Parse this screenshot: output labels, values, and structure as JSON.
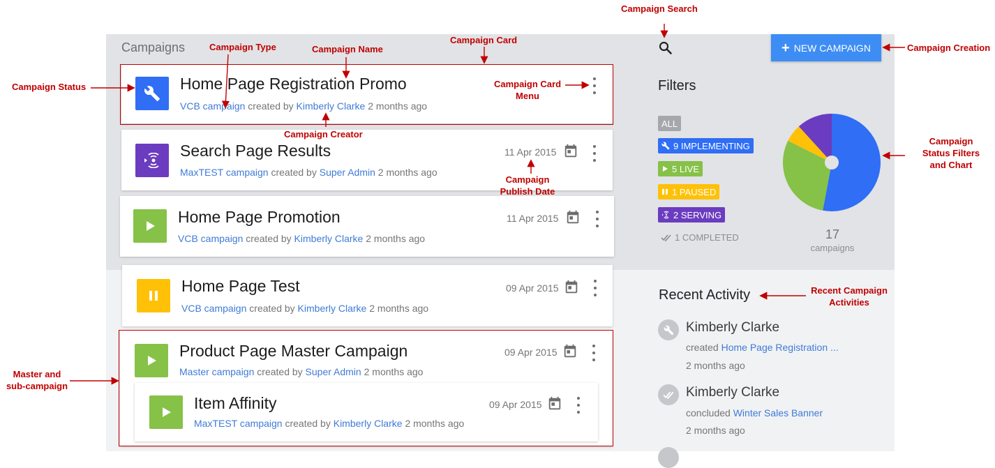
{
  "header": {
    "title": "Campaigns",
    "new_campaign_label": "NEW CAMPAIGN",
    "search_icon": "search-icon"
  },
  "campaigns": [
    {
      "title": "Home Page Registration Promo",
      "type": "VCB campaign",
      "creator": "Kimberly Clarke",
      "age": "2 months ago",
      "date": "",
      "status": "implementing",
      "icon": "wrench-icon"
    },
    {
      "title": "Search Page Results",
      "type": "MaxTEST campaign",
      "creator": "Super Admin",
      "age": "2 months ago",
      "date": "11 Apr 2015",
      "status": "serving",
      "icon": "serving-icon"
    },
    {
      "title": "Home Page Promotion",
      "type": "VCB campaign",
      "creator": "Kimberly Clarke",
      "age": "2 months ago",
      "date": "11 Apr 2015",
      "status": "live",
      "icon": "play-icon"
    },
    {
      "title": "Home Page Test",
      "type": "VCB campaign",
      "creator": "Kimberly Clarke",
      "age": "2 months ago",
      "date": "09 Apr 2015",
      "status": "paused",
      "icon": "pause-icon"
    },
    {
      "title": "Product Page Master Campaign",
      "type": "Master campaign",
      "creator": "Super Admin",
      "age": "2 months ago",
      "date": "09 Apr 2015",
      "status": "live",
      "icon": "play-icon"
    },
    {
      "title": "Item Affinity",
      "type": "MaxTEST campaign",
      "creator": "Kimberly Clarke",
      "age": "2 months ago",
      "date": "09 Apr 2015",
      "status": "live",
      "icon": "play-icon"
    }
  ],
  "created_by_word": "created by",
  "filters": {
    "title": "Filters",
    "all": "ALL",
    "implementing": "9 IMPLEMENTING",
    "live": "5 LIVE",
    "paused": "1 PAUSED",
    "serving": "2 SERVING",
    "completed": "1 COMPLETED"
  },
  "chart_data": {
    "type": "pie",
    "categories": [
      "IMPLEMENTING",
      "LIVE",
      "PAUSED",
      "SERVING"
    ],
    "values": [
      9,
      5,
      1,
      2
    ],
    "colors": [
      "#2f6ef5",
      "#86c148",
      "#ffc107",
      "#6b3cbf"
    ],
    "total": "17",
    "total_label": "campaigns"
  },
  "recent_activity": {
    "title": "Recent Activity",
    "items": [
      {
        "name": "Kimberly Clarke",
        "verb": "created",
        "target": "Home Page Registration ...",
        "time": "2 months ago",
        "icon": "wrench-icon"
      },
      {
        "name": "Kimberly Clarke",
        "verb": "concluded",
        "target": "Winter Sales Banner",
        "time": "2 months ago",
        "icon": "double-check-icon"
      }
    ]
  },
  "annotations": {
    "campaign_search": "Campaign Search",
    "campaign_type": "Campaign Type",
    "campaign_name": "Campaign Name",
    "campaign_card": "Campaign Card",
    "campaign_creation": "Campaign Creation",
    "campaign_status": "Campaign Status",
    "campaign_card_menu_1": "Campaign Card",
    "campaign_card_menu_2": "Menu",
    "campaign_creator": "Campaign Creator",
    "publish_date_1": "Campaign",
    "publish_date_2": "Publish Date",
    "status_filters_1": "Campaign",
    "status_filters_2": "Status Filters",
    "status_filters_3": "and Chart",
    "recent_1": "Recent Campaign",
    "recent_2": "Activities",
    "master_1": "Master and",
    "master_2": "sub-campaign"
  },
  "colors": {
    "accent": "#3d8df5",
    "annotation": "#c00000",
    "link": "#3f7bd6"
  }
}
